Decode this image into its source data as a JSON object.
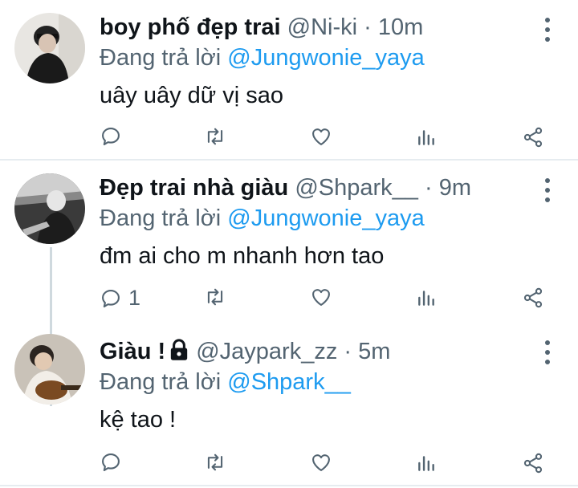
{
  "tweets": [
    {
      "name": "boy phố đẹp trai",
      "handle": "@Ni-ki",
      "dot": "·",
      "time": "10m",
      "reply_prefix": "Đang trả lời",
      "reply_to": "@Jungwonie_yaya",
      "text": "uây uây dữ vị sao",
      "reply_count": ""
    },
    {
      "name": "Đẹp trai nhà giàu",
      "handle": "@Shpark__",
      "dot": "·",
      "time": "9m",
      "reply_prefix": "Đang trả lời",
      "reply_to": "@Jungwonie_yaya",
      "text": "đm ai cho m nhanh hơn tao",
      "reply_count": "1"
    },
    {
      "name": "Giàu !",
      "handle": "@Jaypark_zz",
      "dot": "·",
      "time": "5m",
      "reply_prefix": "Đang trả lời",
      "reply_to": "@Shpark__",
      "text": "kệ tao !",
      "reply_count": ""
    }
  ],
  "colors": {
    "text": "#0f1419",
    "secondary": "#536471",
    "link": "#1d9bf0",
    "divider": "#e6ecf0"
  },
  "icons": [
    "reply-icon",
    "retweet-icon",
    "like-icon",
    "analytics-icon",
    "share-icon",
    "more-icon",
    "lock-icon"
  ]
}
